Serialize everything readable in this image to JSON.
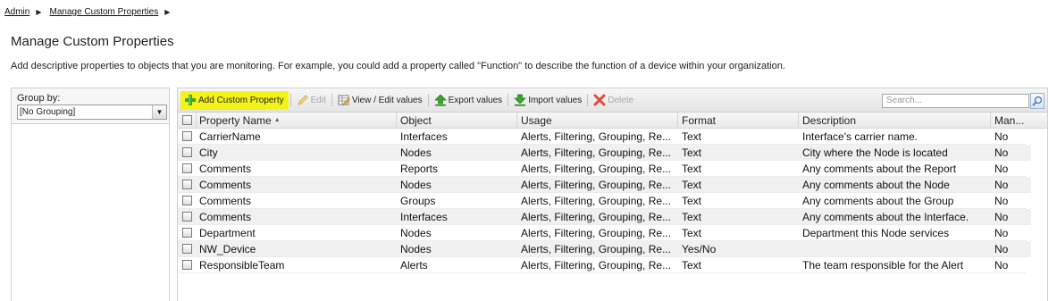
{
  "breadcrumb": [
    {
      "label": "Admin"
    },
    {
      "label": "Manage Custom Properties"
    }
  ],
  "page": {
    "title": "Manage Custom Properties",
    "description": "Add descriptive properties to objects that you are monitoring. For example, you could add a property called \"Function\" to describe the function of a device within your organization."
  },
  "group_by": {
    "label": "Group by:",
    "selected": "[No Grouping]"
  },
  "toolbar": {
    "add_label": "Add Custom Property",
    "edit_label": "Edit",
    "view_edit_label": "View / Edit values",
    "export_label": "Export values",
    "import_label": "Import values",
    "delete_label": "Delete",
    "search_placeholder": "Search..."
  },
  "table": {
    "columns": [
      "Property Name",
      "Object",
      "Usage",
      "Format",
      "Description",
      "Man..."
    ],
    "rows": [
      {
        "name": "CarrierName",
        "object": "Interfaces",
        "usage": "Alerts, Filtering, Grouping, Re...",
        "format": "Text",
        "description": "Interface's carrier name.",
        "mandatory": "No"
      },
      {
        "name": "City",
        "object": "Nodes",
        "usage": "Alerts, Filtering, Grouping, Re...",
        "format": "Text",
        "description": "City where the Node is located",
        "mandatory": "No"
      },
      {
        "name": "Comments",
        "object": "Reports",
        "usage": "Alerts, Filtering, Grouping, Re...",
        "format": "Text",
        "description": "Any comments about the Report",
        "mandatory": "No"
      },
      {
        "name": "Comments",
        "object": "Nodes",
        "usage": "Alerts, Filtering, Grouping, Re...",
        "format": "Text",
        "description": "Any comments about the Node",
        "mandatory": "No"
      },
      {
        "name": "Comments",
        "object": "Groups",
        "usage": "Alerts, Filtering, Grouping, Re...",
        "format": "Text",
        "description": "Any comments about the Group",
        "mandatory": "No"
      },
      {
        "name": "Comments",
        "object": "Interfaces",
        "usage": "Alerts, Filtering, Grouping, Re...",
        "format": "Text",
        "description": "Any comments about the Interface.",
        "mandatory": "No"
      },
      {
        "name": "Department",
        "object": "Nodes",
        "usage": "Alerts, Filtering, Grouping, Re...",
        "format": "Text",
        "description": "Department this Node services",
        "mandatory": "No"
      },
      {
        "name": "NW_Device",
        "object": "Nodes",
        "usage": "Alerts, Filtering, Grouping, Re...",
        "format": "Yes/No",
        "description": "",
        "mandatory": "No"
      },
      {
        "name": "ResponsibleTeam",
        "object": "Alerts",
        "usage": "Alerts, Filtering, Grouping, Re...",
        "format": "Text",
        "description": "The team responsible for the Alert",
        "mandatory": "No"
      }
    ]
  },
  "colors": {
    "highlight": "#f3f31a",
    "add_icon": "#3aa42c",
    "delete_icon": "#e04a3a"
  }
}
